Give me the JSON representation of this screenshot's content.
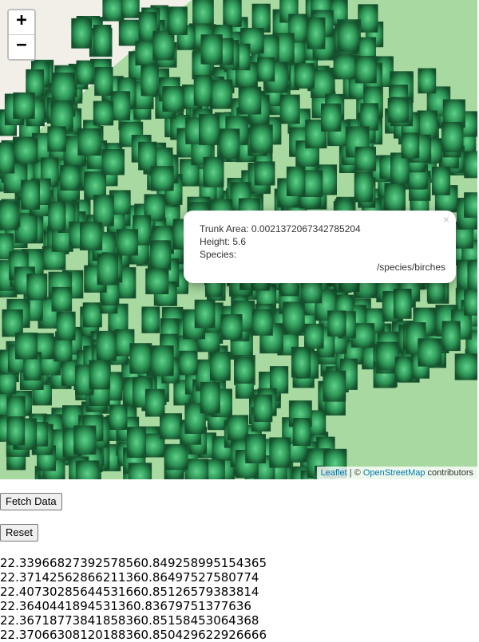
{
  "map": {
    "zoom_in_label": "+",
    "zoom_out_label": "−",
    "colors": {
      "forest_green": "#a7d9a0",
      "land_grey": "#f2efe9",
      "tree_dark": "#1f6b3e",
      "tree_light": "#3fb36a"
    },
    "popup": {
      "close_label": "×",
      "trunk_area_label": "Trunk Area: 0.0021372067342785204",
      "height_label": "Height: 5.6",
      "species_label": "Species:",
      "species_link": "/species/birches"
    },
    "attribution": {
      "leaflet_label": "Leaflet",
      "separator": " | © ",
      "osm_label": "OpenStreetMap",
      "suffix": " contributors"
    }
  },
  "controls": {
    "fetch_label": "Fetch Data",
    "reset_label": "Reset"
  },
  "output": {
    "lines": [
      "22.3396682739257856­0.849258995154365",
      "22.37142562866211360.86497527580774",
      "22.40730285644531660.85126579383814",
      "22.3640441894531360.83679751377636",
      "22.3671877384185836­0.85158453064368",
      "22.3706630812018836­0.850429622926666"
    ]
  }
}
